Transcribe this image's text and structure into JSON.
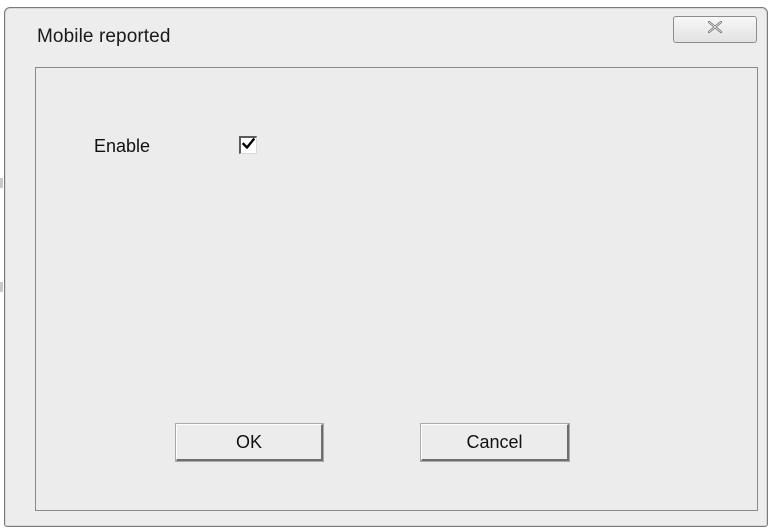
{
  "window": {
    "title": "Mobile reported"
  },
  "form": {
    "enable_label": "Enable",
    "enable_checked": true
  },
  "buttons": {
    "ok_label": "OK",
    "cancel_label": "Cancel"
  },
  "icons": {
    "close": "close-x-icon",
    "check": "checkmark-icon"
  }
}
